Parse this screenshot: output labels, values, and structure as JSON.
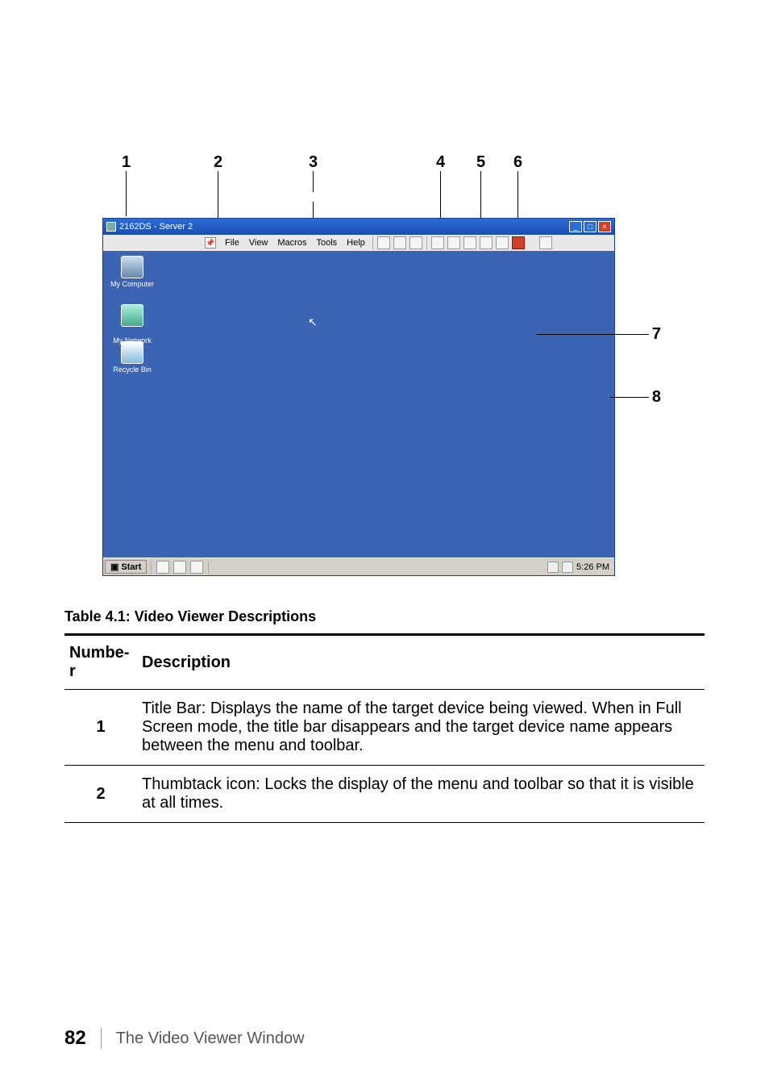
{
  "callouts": {
    "n1": "1",
    "n2": "2",
    "n3": "3",
    "n4": "4",
    "n5": "5",
    "n6": "6",
    "n7": "7",
    "n8": "8"
  },
  "window": {
    "title": "2162DS - Server 2",
    "menu": {
      "file": "File",
      "view": "View",
      "macros": "Macros",
      "tools": "Tools",
      "help": "Help"
    },
    "desktop_icons": {
      "my_computer": "My Computer",
      "my_network_places": "My Network\nPlaces",
      "recycle_bin": "Recycle Bin"
    },
    "taskbar": {
      "start": "Start",
      "time": "5:26 PM"
    }
  },
  "table": {
    "title": "Table 4.1: Video Viewer Descriptions",
    "head_number": "Numbe-r",
    "head_desc": "Description",
    "rows": [
      {
        "num": "1",
        "desc": "Title Bar: Displays the name of the target device being viewed. When in Full Screen mode, the title bar disappears and the target device name appears between the menu and toolbar."
      },
      {
        "num": "2",
        "desc": "Thumbtack icon: Locks the display of the menu and toolbar so that it is visible at all times."
      }
    ]
  },
  "footer": {
    "page": "82",
    "chapter": "The Video Viewer Window"
  }
}
